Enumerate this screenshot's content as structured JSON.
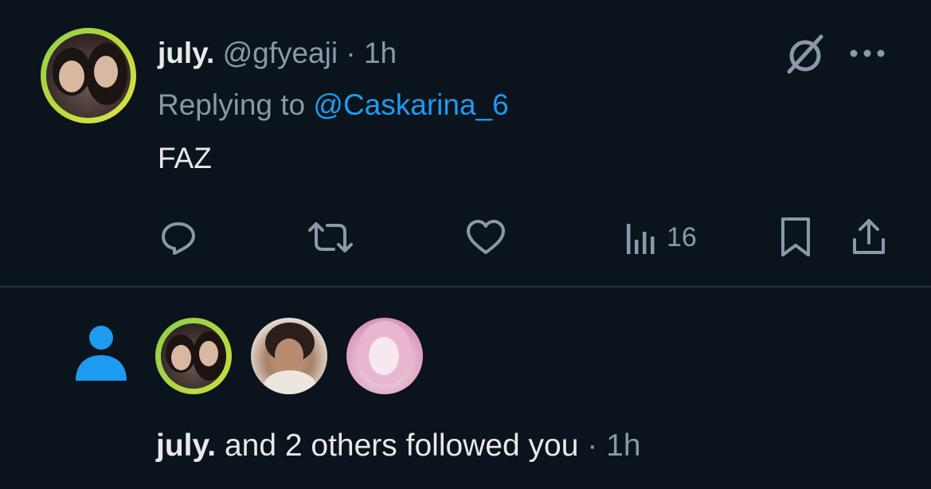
{
  "tweet": {
    "author_name": "july.",
    "handle": "@gfyeaji",
    "separator": "·",
    "time": "1h",
    "replying_prefix": "Replying to",
    "reply_mention": "@Caskarina_6",
    "text": "FAZ",
    "grok_icon": "grok-icon",
    "more_icon": "more-icon",
    "actions": {
      "reply_icon": "reply-icon",
      "retweet_icon": "retweet-icon",
      "like_icon": "heart-icon",
      "views_icon": "views-icon",
      "views_count": "16",
      "bookmark_icon": "bookmark-icon",
      "share_icon": "share-icon"
    }
  },
  "notification": {
    "icon": "person-icon",
    "actor_name": "july.",
    "message": "and 2 others followed you",
    "separator": "·",
    "time": "1h"
  },
  "colors": {
    "background": "#0b131c",
    "text": "#e7e9ea",
    "muted": "#8b98a5",
    "accent": "#1d9bf0",
    "avatar_ring": "#a5d646"
  }
}
